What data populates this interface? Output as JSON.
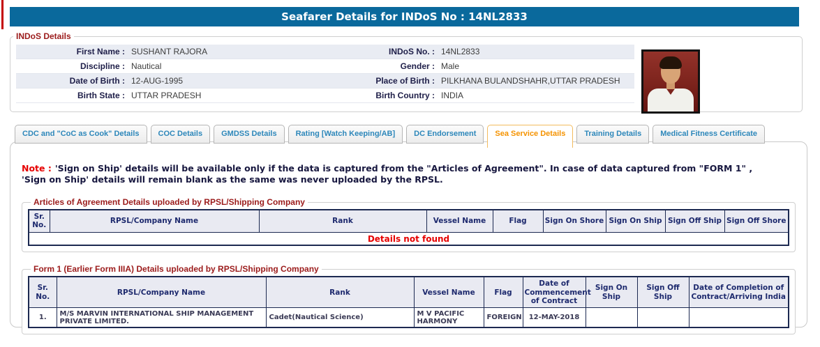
{
  "header": {
    "title": "Seafarer Details for INDoS No : 14NL2833"
  },
  "indos": {
    "legend": "INDoS Details",
    "rows": [
      {
        "l1": "First Name :",
        "v1": "SUSHANT RAJORA",
        "l2": "INDoS No. :",
        "v2": "14NL2833"
      },
      {
        "l1": "Discipline :",
        "v1": "Nautical",
        "l2": "Gender :",
        "v2": "Male"
      },
      {
        "l1": "Date of Birth :",
        "v1": "12-AUG-1995",
        "l2": "Place of Birth :",
        "v2": "PILKHANA BULANDSHAHR,UTTAR PRADESH"
      },
      {
        "l1": "Birth State :",
        "v1": "UTTAR PRADESH",
        "l2": "Birth Country :",
        "v2": "INDIA"
      }
    ],
    "photo_alt": "Seafarer photograph"
  },
  "tabs": {
    "items": [
      {
        "label": "CDC and \"CoC as Cook\" Details",
        "active": false
      },
      {
        "label": "COC Details",
        "active": false
      },
      {
        "label": "GMDSS Details",
        "active": false
      },
      {
        "label": "Rating [Watch Keeping/AB]",
        "active": false
      },
      {
        "label": "DC Endorsement",
        "active": false
      },
      {
        "label": "Sea Service Details",
        "active": true
      },
      {
        "label": "Training Details",
        "active": false
      },
      {
        "label": "Medical Fitness Certificate",
        "active": false
      }
    ]
  },
  "note": {
    "prefix": "Note :",
    "text": "'Sign on Ship' details will be available only if the data is captured from the \"Articles of Agreement\". In case of data captured from \"FORM 1\" , 'Sign on Ship' details will remain blank as the same was never uploaded by the RPSL."
  },
  "articles_table": {
    "legend": "Articles of Agreement Details uploaded by RPSL/Shipping Company",
    "headers": [
      "Sr. No.",
      "RPSL/Company Name",
      "Rank",
      "Vessel Name",
      "Flag",
      "Sign On Shore",
      "Sign On Ship",
      "Sign Off Ship",
      "Sign Off Shore"
    ],
    "empty_message": "Details not found"
  },
  "form1_table": {
    "legend": "Form 1 (Earlier Form IIIA) Details uploaded by RPSL/Shipping Company",
    "headers": [
      "Sr. No.",
      "RPSL/Company Name",
      "Rank",
      "Vessel Name",
      "Flag",
      "Date of Commencement of Contract",
      "Sign On Ship",
      "Sign Off Ship",
      "Date of Completion of Contract/Arriving India"
    ],
    "rows": [
      {
        "sr": "1.",
        "company": "M/S MARVIN INTERNATIONAL SHIP MANAGEMENT PRIVATE LIMITED.",
        "rank": "Cadet(Nautical Science)",
        "vessel": "M V PACIFIC HARMONY",
        "flag": "FOREIGN",
        "date_of_commencement": "12-MAY-2018",
        "sign_on_ship": "",
        "sign_off_ship": "",
        "date_of_completion": ""
      }
    ]
  },
  "colors": {
    "title_bar_blue": "#0a699c",
    "legend_red": "#9b1b1b",
    "note_red": "#e60000",
    "tab_blue": "#2d87ba",
    "tab_active_orange": "#f59300",
    "table_border_navy": "#1c2951",
    "row_stripe": "#e9ecf3"
  }
}
